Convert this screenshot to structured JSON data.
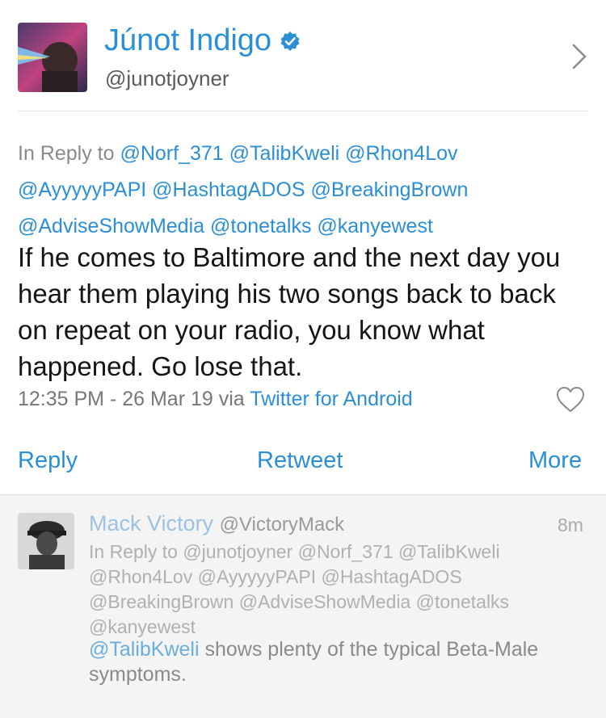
{
  "tweet": {
    "author_name": "Júnot Indigo",
    "author_handle": "@junotjoyner",
    "reply_to_label": "In Reply to",
    "reply_to_mentions": [
      "@Norf_371",
      "@TalibKweli",
      "@Rhon4Lov",
      "@AyyyyyPAPI",
      "@HashtagADOS",
      "@BreakingBrown",
      "@AdviseShowMedia",
      "@tonetalks",
      "@kanyewest"
    ],
    "text": "If he comes to Baltimore and the next day you hear them playing his two songs back to back on repeat on your radio, you know what happened. Go lose that.",
    "timestamp": "12:35 PM - 26 Mar 19 via",
    "source": "Twitter for Android"
  },
  "actions": {
    "reply": "Reply",
    "retweet": "Retweet",
    "more": "More"
  },
  "reply": {
    "author_name": "Mack Victory",
    "author_handle": "@VictoryMack",
    "time": "8m",
    "reply_to_text": "In Reply to @junotjoyner @Norf_371 @TalibKweli @Rhon4Lov @AyyyyyPAPI @HashtagADOS @BreakingBrown @AdviseShowMedia @tonetalks @kanyewest",
    "mention": "@TalibKweli",
    "text": " shows plenty of the typical Beta-Male symptoms."
  },
  "colors": {
    "accent": "#2b8fd7",
    "muted": "#8a8a8a",
    "reply_bg": "#f4f4f4"
  },
  "icons": {
    "verified": "verified-badge-icon",
    "chevron": "chevron-right-icon",
    "heart": "heart-outline-icon"
  }
}
